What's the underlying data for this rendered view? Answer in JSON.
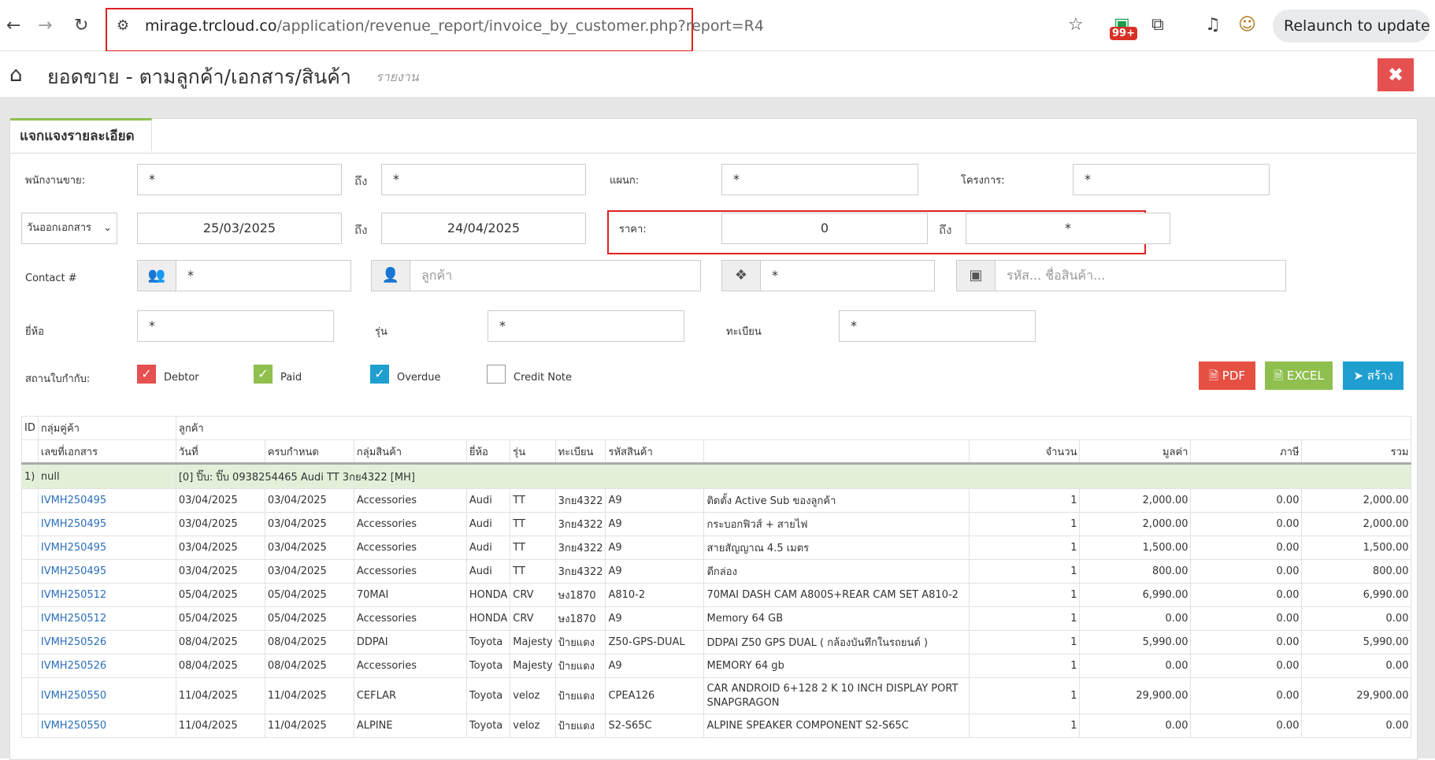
{
  "browser": {
    "url_host": "mirage.trcloud.co",
    "url_path": "/application/revenue_report/invoice_by_customer.php?report=R4",
    "badge_count": "99+",
    "relaunch_label": "Relaunch to update"
  },
  "page": {
    "title": "ยอดขาย - ตามลูกค้า/เอกสาร/สินค้า",
    "subtitle": "รายงาน",
    "close_glyph": "✖",
    "tab_label": "แจกแจงรายละเอียด"
  },
  "filters": {
    "salesperson_label": "พนักงานขาย:",
    "salesperson_from": "*",
    "to_label": "ถึง",
    "salesperson_to": "*",
    "department_label": "แผนก:",
    "department": "*",
    "project_label": "โครงการ:",
    "project": "*",
    "date_type": "วันออกเอกสาร",
    "date_from": "25/03/2025",
    "date_to": "24/04/2025",
    "price_label": "ราคา:",
    "price_from": "0",
    "price_to": "*",
    "contact_label": "Contact #",
    "contact": "*",
    "customer_placeholder": "ลูกค้า",
    "product_group": "*",
    "product_placeholder": "รหัส... ชื่อสินค้า...",
    "brand_label": "ยี่ห้อ",
    "brand": "*",
    "model_label": "รุ่น",
    "model": "*",
    "plate_label": "ทะเบียน",
    "plate": "*",
    "status_label": "สถานใบกำกับ:",
    "statuses": [
      {
        "label": "Debtor",
        "checked": true,
        "color": "#e55050"
      },
      {
        "label": "Paid",
        "checked": true,
        "color": "#8fbf4e"
      },
      {
        "label": "Overdue",
        "checked": true,
        "color": "#1e9fd0"
      },
      {
        "label": "Credit Note",
        "checked": false,
        "color": "#ffffff"
      }
    ]
  },
  "buttons": {
    "pdf": "PDF",
    "excel": "EXCEL",
    "create": "สร้าง",
    "pdf_color": "#e55043",
    "excel_color": "#8fbf4e",
    "create_color": "#1e9fd0"
  },
  "table": {
    "header1": {
      "id": "ID",
      "customer_group": "กลุ่มคู่ค้า",
      "customer": "ลูกค้า"
    },
    "header2": [
      "เลขที่เอกสาร",
      "วันที่",
      "ครบกำหนด",
      "กลุ่มสินค้า",
      "ยี่ห้อ",
      "รุ่น",
      "ทะเบียน",
      "รหัสสินค้า",
      "",
      "จำนวน",
      "มูลค่า",
      "ภาษี",
      "รวม"
    ],
    "group": {
      "id": "1)",
      "group": "null",
      "customer": "[0] ปิ๊บ: ปิ๊บ 0938254465 Audi TT 3กย4322 [MH]"
    },
    "rows": [
      [
        "IVMH250495",
        "03/04/2025",
        "03/04/2025",
        "Accessories",
        "Audi",
        "TT",
        "3กย4322",
        "A9",
        "ติดตั้ง Active Sub ของลูกค้า",
        "1",
        "2,000.00",
        "0.00",
        "2,000.00"
      ],
      [
        "IVMH250495",
        "03/04/2025",
        "03/04/2025",
        "Accessories",
        "Audi",
        "TT",
        "3กย4322",
        "A9",
        "กระบอกฟิวส์ + สายไฟ",
        "1",
        "2,000.00",
        "0.00",
        "2,000.00"
      ],
      [
        "IVMH250495",
        "03/04/2025",
        "03/04/2025",
        "Accessories",
        "Audi",
        "TT",
        "3กย4322",
        "A9",
        "สายสัญญาณ 4.5 เมตร",
        "1",
        "1,500.00",
        "0.00",
        "1,500.00"
      ],
      [
        "IVMH250495",
        "03/04/2025",
        "03/04/2025",
        "Accessories",
        "Audi",
        "TT",
        "3กย4322",
        "A9",
        "ตีกล่อง",
        "1",
        "800.00",
        "0.00",
        "800.00"
      ],
      [
        "IVMH250512",
        "05/04/2025",
        "05/04/2025",
        "70MAI",
        "HONDA",
        "CRV",
        "ษง1870",
        "A810-2",
        "70MAI DASH CAM A800S+REAR CAM SET A810-2",
        "1",
        "6,990.00",
        "0.00",
        "6,990.00"
      ],
      [
        "IVMH250512",
        "05/04/2025",
        "05/04/2025",
        "Accessories",
        "HONDA",
        "CRV",
        "ษง1870",
        "A9",
        "Memory 64 GB",
        "1",
        "0.00",
        "0.00",
        "0.00"
      ],
      [
        "IVMH250526",
        "08/04/2025",
        "08/04/2025",
        "DDPAI",
        "Toyota",
        "Majesty",
        "ป้ายแดง",
        "Z50-GPS-DUAL",
        "DDPAI Z50 GPS DUAL ( กล้องบันทึกในรถยนต์ )",
        "1",
        "5,990.00",
        "0.00",
        "5,990.00"
      ],
      [
        "IVMH250526",
        "08/04/2025",
        "08/04/2025",
        "Accessories",
        "Toyota",
        "Majesty",
        "ป้ายแดง",
        "A9",
        "MEMORY 64 gb",
        "1",
        "0.00",
        "0.00",
        "0.00"
      ],
      [
        "IVMH250550",
        "11/04/2025",
        "11/04/2025",
        "CEFLAR",
        "Toyota",
        "veloz",
        "ป้ายแดง",
        "CPEA126",
        "CAR ANDROID 6+128 2 K 10 INCH DISPLAY PORT SNAPGRAGON",
        "1",
        "29,900.00",
        "0.00",
        "29,900.00"
      ],
      [
        "IVMH250550",
        "11/04/2025",
        "11/04/2025",
        "ALPINE",
        "Toyota",
        "veloz",
        "ป้ายแดง",
        "S2-S65C",
        "ALPINE SPEAKER COMPONENT S2-S65C",
        "1",
        "0.00",
        "0.00",
        "0.00"
      ]
    ]
  }
}
